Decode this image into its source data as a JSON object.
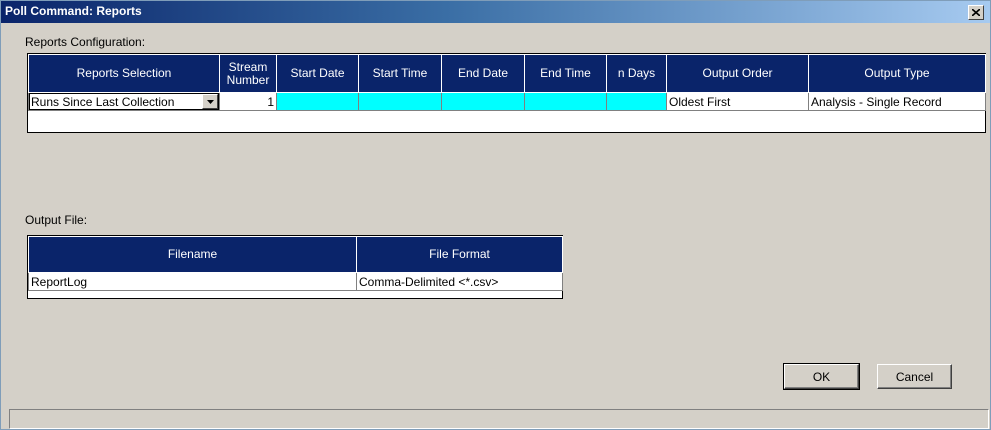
{
  "window": {
    "title": "Poll Command: Reports",
    "close_icon": "close-icon"
  },
  "reports_config": {
    "label": "Reports Configuration:",
    "columns": {
      "reports_selection": "Reports Selection",
      "stream_number_line1": "Stream",
      "stream_number_line2": "Number",
      "start_date": "Start Date",
      "start_time": "Start Time",
      "end_date": "End Date",
      "end_time": "End Time",
      "n_days": "n Days",
      "output_order": "Output Order",
      "output_type": "Output Type"
    },
    "row": {
      "reports_selection": "Runs Since Last Collection",
      "stream_number": "1",
      "start_date": "",
      "start_time": "",
      "end_date": "",
      "end_time": "",
      "n_days": "",
      "output_order": "Oldest First",
      "output_type": "Analysis - Single Record"
    },
    "highlight_color": "#00ffff",
    "header_color": "#0a246a"
  },
  "output_file": {
    "label": "Output File:",
    "columns": {
      "filename": "Filename",
      "file_format": "File Format"
    },
    "row": {
      "filename": "ReportLog",
      "file_format": "Comma-Delimited <*.csv>"
    }
  },
  "buttons": {
    "ok": "OK",
    "cancel": "Cancel"
  }
}
